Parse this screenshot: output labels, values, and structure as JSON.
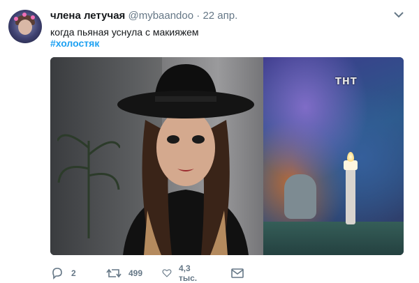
{
  "tweet": {
    "author_name": "члена летучая",
    "author_handle": "@mybaandoo",
    "separator": "·",
    "date": "22 апр.",
    "text": "когда пьяная уснула с макияжем",
    "hashtag": "#холостяк",
    "media_overlay": "ТНТ"
  },
  "actions": {
    "reply_count": "2",
    "retweet_count": "499",
    "like_count": "4,3 тыс."
  },
  "icons": [
    "avatar",
    "chevron-down-icon",
    "reply-icon",
    "retweet-icon",
    "like-icon",
    "message-icon"
  ],
  "colors": {
    "hashtag": "#1da1f2",
    "secondary_text": "#657786",
    "primary_text": "#14171a"
  }
}
